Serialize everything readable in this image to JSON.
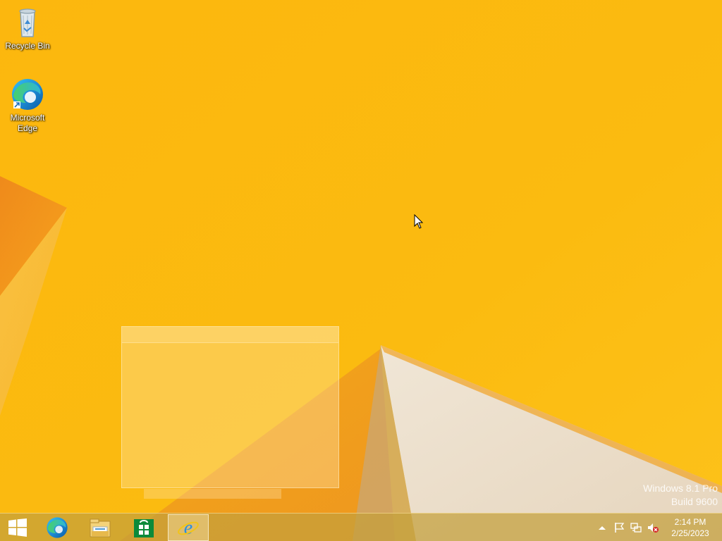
{
  "desktop": {
    "icons": [
      {
        "label": "Recycle Bin"
      },
      {
        "label": "Microsoft Edge"
      }
    ]
  },
  "watermark": {
    "line1": "Windows 8.1 Pro",
    "line2": "Build 9600"
  },
  "taskbar": {
    "buttons": [
      {
        "name": "start",
        "icon": "windows-logo-icon"
      },
      {
        "name": "edge",
        "icon": "edge-icon"
      },
      {
        "name": "file-explorer",
        "icon": "folder-icon"
      },
      {
        "name": "store",
        "icon": "store-icon"
      },
      {
        "name": "internet-explorer",
        "icon": "ie-icon",
        "active": true
      }
    ]
  },
  "tray": {
    "icons": [
      "chevron-up-icon",
      "flag-icon",
      "network-icon",
      "volume-muted-icon"
    ],
    "time": "2:14 PM",
    "date": "2/25/2023"
  },
  "colors": {
    "wallpaper_base": "#fbb80e",
    "wallpaper_orange": "#f08a1c",
    "wallpaper_light": "#ecdcc8",
    "taskbar": "#c4a03c"
  }
}
